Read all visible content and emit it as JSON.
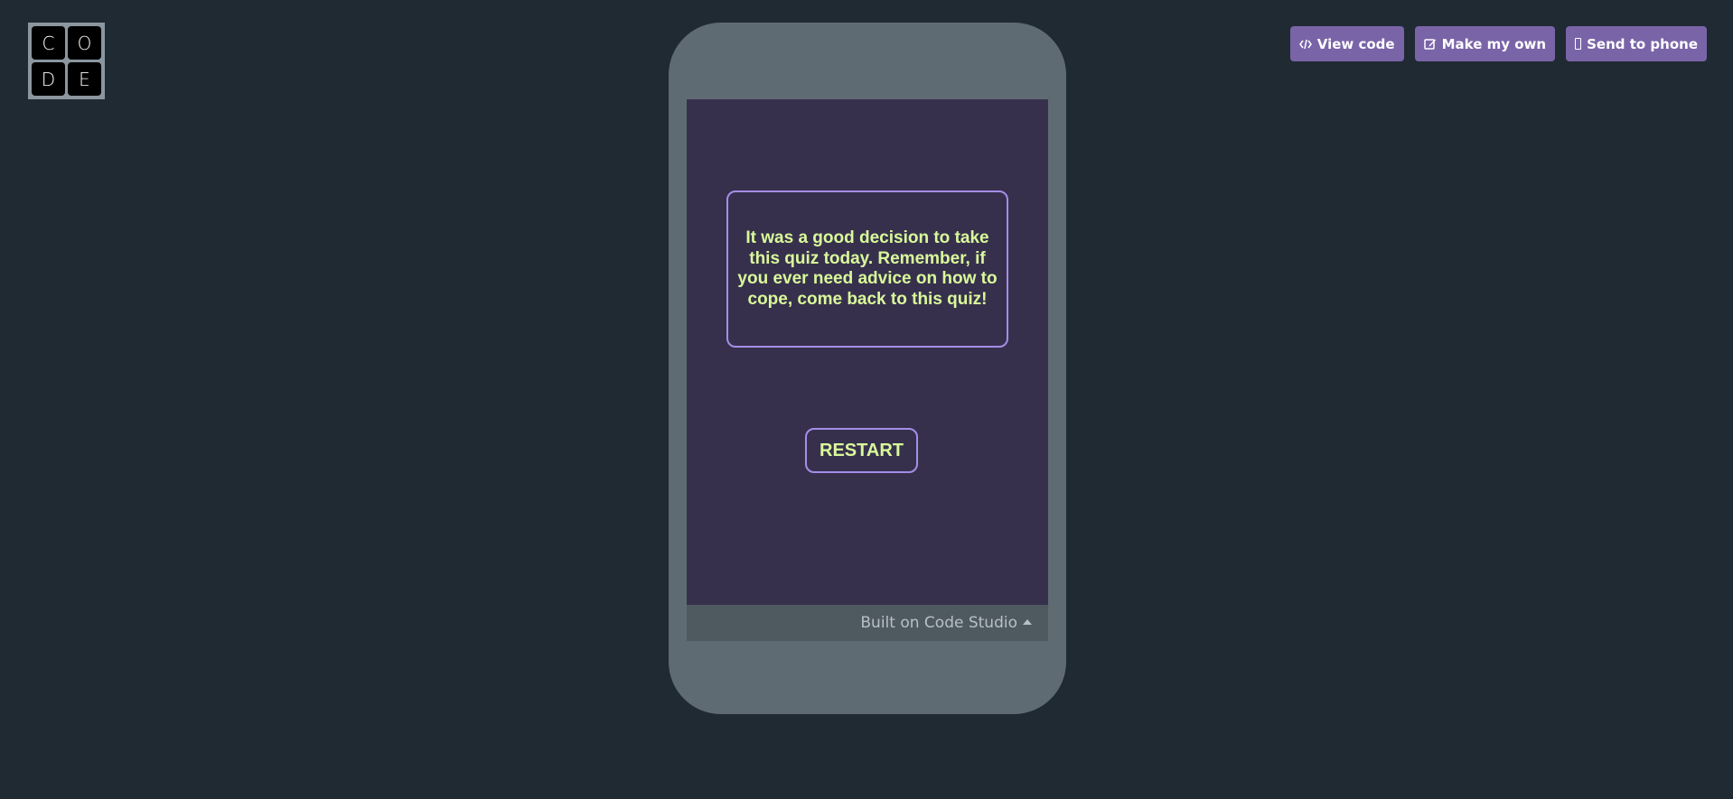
{
  "logo": {
    "letters": [
      "C",
      "O",
      "D",
      "E"
    ]
  },
  "toolbar": {
    "view_code": {
      "icon": "code-icon",
      "label": "View code"
    },
    "make_my_own": {
      "icon": "edit-icon",
      "label": "Make my own"
    },
    "send_to_phone": {
      "icon": "mobile-phone-icon",
      "label": "Send to phone"
    }
  },
  "app": {
    "message": "It was a good decision to take this quiz today. Remember, if you ever need advice on how to cope, come back to this quiz!",
    "restart_label": "RESTART",
    "colors": {
      "screen_bg": "#37304d",
      "text": "#d9f99a",
      "border": "#a48ee8"
    }
  },
  "footer": {
    "label": "Built on Code Studio"
  },
  "colors": {
    "page_bg": "#202a33",
    "phone_frame": "#5f6b73",
    "button_bg": "#7a64a8"
  }
}
